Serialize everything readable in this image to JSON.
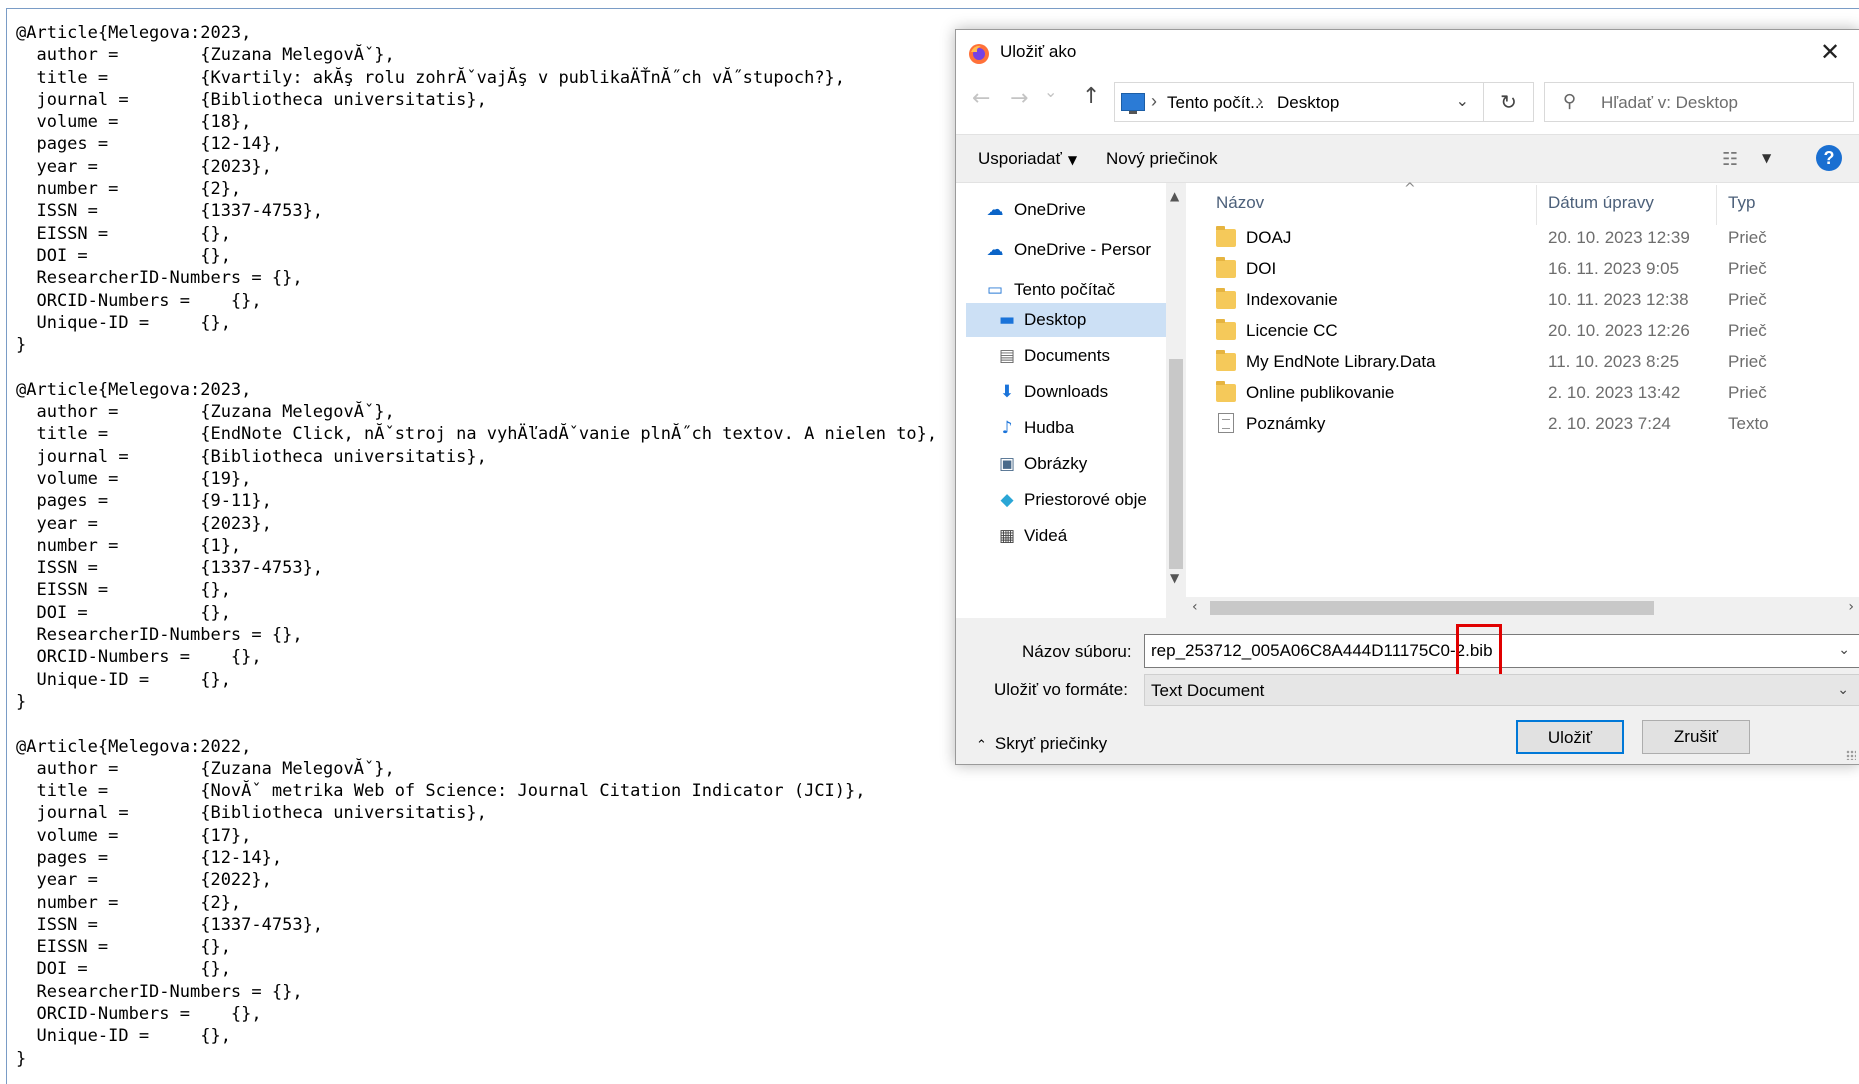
{
  "editor": {
    "text": "@Article{Melegova:2023,\n  author =        {Zuzana MelegovĂˇ},\n  title =         {Kvartily: akĂş rolu zohrĂˇvajĂş v publikaÄŤnĂ˝ch vĂ˝stupoch?},\n  journal =       {Bibliotheca universitatis},\n  volume =        {18},\n  pages =         {12-14},\n  year =          {2023},\n  number =        {2},\n  ISSN =          {1337-4753},\n  EISSN =         {},\n  DOI =           {},\n  ResearcherID-Numbers = {},\n  ORCID-Numbers =    {},\n  Unique-ID =     {},\n}\n\n@Article{Melegova:2023,\n  author =        {Zuzana MelegovĂˇ},\n  title =         {EndNote Click, nĂˇstroj na vyhÄľadĂˇvanie plnĂ˝ch textov. A nielen to},\n  journal =       {Bibliotheca universitatis},\n  volume =        {19},\n  pages =         {9-11},\n  year =          {2023},\n  number =        {1},\n  ISSN =          {1337-4753},\n  EISSN =         {},\n  DOI =           {},\n  ResearcherID-Numbers = {},\n  ORCID-Numbers =    {},\n  Unique-ID =     {},\n}\n\n@Article{Melegova:2022,\n  author =        {Zuzana MelegovĂˇ},\n  title =         {NovĂˇ metrika Web of Science: Journal Citation Indicator (JCI)},\n  journal =       {Bibliotheca universitatis},\n  volume =        {17},\n  pages =         {12-14},\n  year =          {2022},\n  number =        {2},\n  ISSN =          {1337-4753},\n  EISSN =         {},\n  DOI =           {},\n  ResearcherID-Numbers = {},\n  ORCID-Numbers =    {},\n  Unique-ID =     {},\n}"
  },
  "dialog": {
    "title": "Uložiť ako",
    "icons": {
      "app": "firefox-icon",
      "close": "close-icon"
    },
    "nav": {
      "back": "←",
      "forward": "→",
      "recent": "⌄",
      "up": "↑",
      "breadcrumbs": [
        "Tento počít...",
        "Desktop"
      ],
      "search_placeholder": "Hľadať v: Desktop"
    },
    "toolbar": {
      "organize": "Usporiadať",
      "new_folder": "Nový priečinok",
      "help": "?"
    },
    "sidebar": [
      {
        "label": "OneDrive",
        "icon": "onedrive-icon"
      },
      {
        "label": "OneDrive - Persor",
        "icon": "onedrive-icon"
      },
      {
        "label": "Tento počítač",
        "icon": "computer-icon"
      },
      {
        "label": "Desktop",
        "icon": "desktop-icon",
        "selected": true
      },
      {
        "label": "Documents",
        "icon": "documents-icon"
      },
      {
        "label": "Downloads",
        "icon": "downloads-icon"
      },
      {
        "label": "Hudba",
        "icon": "music-icon"
      },
      {
        "label": "Obrázky",
        "icon": "pictures-icon"
      },
      {
        "label": "Priestorové obje",
        "icon": "3d-objects-icon"
      },
      {
        "label": "Videá",
        "icon": "videos-icon"
      }
    ],
    "columns": {
      "name": "Názov",
      "date": "Dátum úpravy",
      "type": "Typ"
    },
    "files": [
      {
        "name": "DOAJ",
        "date": "20. 10. 2023 12:39",
        "type": "Prieč",
        "kind": "folder"
      },
      {
        "name": "DOI",
        "date": "16. 11. 2023 9:05",
        "type": "Prieč",
        "kind": "folder"
      },
      {
        "name": "Indexovanie",
        "date": "10. 11. 2023 12:38",
        "type": "Prieč",
        "kind": "folder"
      },
      {
        "name": "Licencie CC",
        "date": "20. 10. 2023 12:26",
        "type": "Prieč",
        "kind": "folder"
      },
      {
        "name": "My EndNote Library.Data",
        "date": "11. 10. 2023 8:25",
        "type": "Prieč",
        "kind": "folder"
      },
      {
        "name": "Online publikovanie",
        "date": "2. 10. 2023 13:42",
        "type": "Prieč",
        "kind": "folder"
      },
      {
        "name": "Poznámky",
        "date": "2. 10. 2023 7:24",
        "type": "Texto",
        "kind": "text"
      }
    ],
    "form": {
      "filename_label": "Názov súboru:",
      "filename_value": "rep_253712_005A06C8A444D11175C0-2.bib",
      "format_label": "Uložiť vo formáte:",
      "format_value": "Text Document"
    },
    "footer": {
      "hide_folders": "Skryť priečinky",
      "save": "Uložiť",
      "cancel": "Zrušiť"
    }
  },
  "colors": {
    "selection": "#cce0f5",
    "accent": "#0078d7",
    "highlight": "#e00000"
  }
}
